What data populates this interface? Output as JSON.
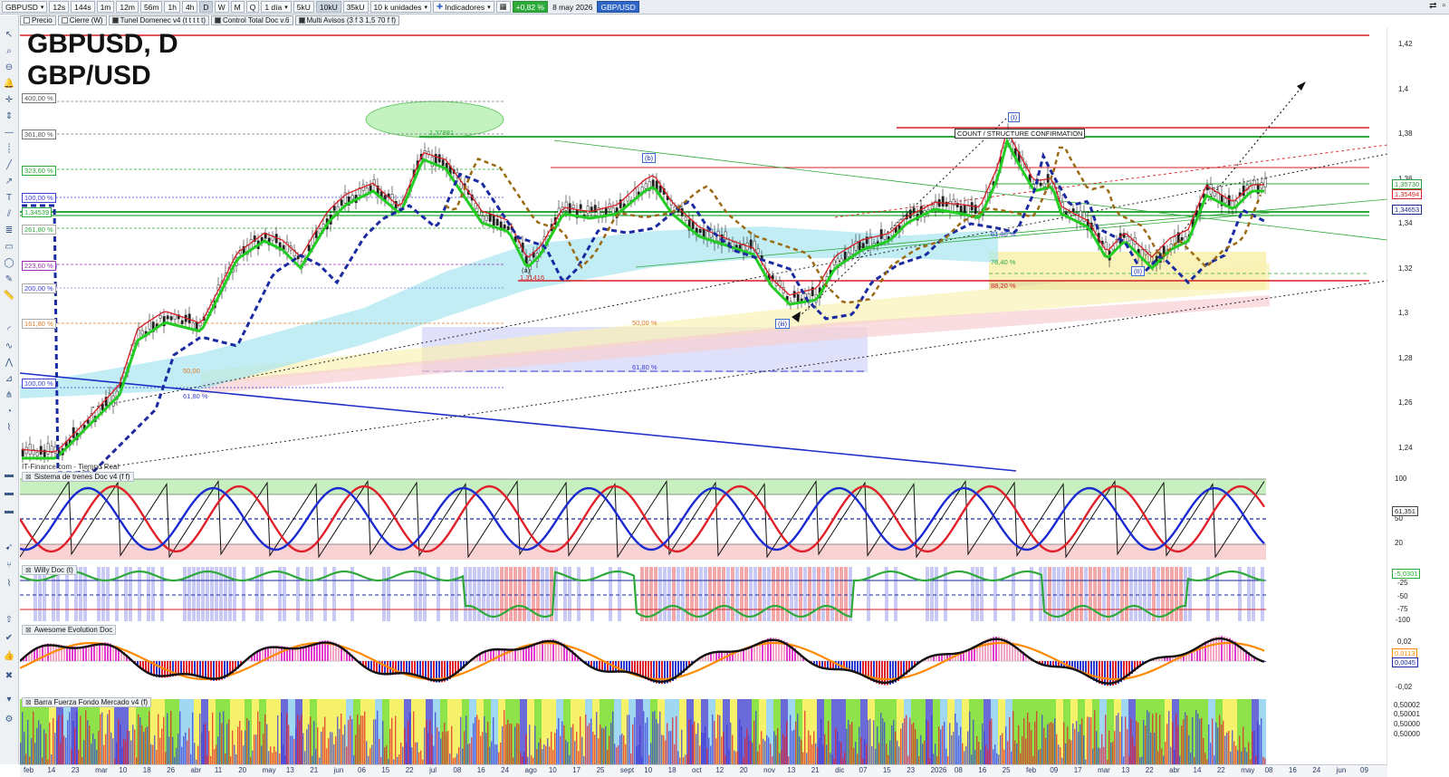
{
  "toolbar": {
    "symbol": "GBPUSD",
    "intervals": [
      "12s",
      "144s",
      "1m",
      "12m",
      "56m",
      "1h",
      "4h",
      "D",
      "W",
      "M",
      "Q"
    ],
    "active_interval": "D",
    "period": "1 día",
    "units": [
      "5kU",
      "10kU",
      "35kU"
    ],
    "active_unit": "10kU",
    "quantity": "10 k unidades",
    "indicators_label": "Indicadores",
    "change": "+0,82 %",
    "date": "8 may 2026",
    "instrument": "GBP/USD"
  },
  "legend": {
    "items": [
      "Precio",
      "Cierre (W)",
      "Tunel Domenec v4 (t t t t t)",
      "Control Total Doc v.6",
      "Multi Avisos (3 f 3 1,5 70 f f)"
    ]
  },
  "title": {
    "line1": "GBPUSD, D",
    "line2": "GBP/USD"
  },
  "source_label": "IT-Finance.com - Tiempo Real",
  "price_axis": {
    "ticks": [
      "1,42",
      "1,4",
      "1,38",
      "1,36",
      "1,34",
      "1,32",
      "1,3",
      "1,28",
      "1,26",
      "1,24"
    ],
    "tags": [
      {
        "text": "1,35730",
        "color": "#2e9a3a"
      },
      {
        "text": "1,35494",
        "color": "#d22"
      },
      {
        "text": "1,34653",
        "color": "#1a2a8a"
      }
    ]
  },
  "fib_left_labels": [
    "400,00 %",
    "361,80 %",
    "323,60 %",
    "100,00 %",
    "1,34539",
    "261,80 %",
    "223,60 %",
    "200,00 %",
    "161,80 %",
    "100,00 %"
  ],
  "annotations": {
    "peak_price": "1,37881",
    "low_price": "1,31416",
    "count_box": "COUNT / STRUCTURE CONFIRMATION",
    "fib_center_50": "50,00 %",
    "fib_center_618": "61,80 %",
    "fib_left_50": "50,00",
    "fib_left_618": "61,80 %",
    "fib_right_618": "61,80 %",
    "fib_right_764": "76,40 %",
    "fib_right_882": "88,20 %",
    "wave_i": "(I)",
    "wave_ii": "(II)",
    "wave_iii": "(iii)",
    "wave_a": "(a)",
    "wave_b": "(b)"
  },
  "panels": {
    "sistema": {
      "title": "Sistema de trenes Doc v4 (f f)",
      "ticks": [
        "100",
        "50",
        "20"
      ],
      "tags": [
        "61,351"
      ]
    },
    "willy": {
      "title": "Willy Doc (t)",
      "ticks": [
        "-25",
        "-50",
        "-75",
        "-100"
      ],
      "tags": [
        "-5,0301"
      ]
    },
    "awesome": {
      "title": "Awesome Evolution Doc",
      "ticks": [
        "0,02",
        "-0,02"
      ],
      "tags": [
        "0,0113",
        "0,0045"
      ]
    },
    "barra": {
      "title": "Barra Fuerza Fondo Mercado v4 (f)",
      "ticks": [
        "0,50002",
        "0,50001",
        "0,50000",
        "0,50000"
      ]
    }
  },
  "x_axis": {
    "labels": [
      "feb",
      "14",
      "23",
      "mar",
      "10",
      "18",
      "26",
      "abr",
      "11",
      "20",
      "may",
      "13",
      "21",
      "jun",
      "06",
      "15",
      "22",
      "jul",
      "08",
      "16",
      "24",
      "ago",
      "10",
      "17",
      "25",
      "sept",
      "10",
      "18",
      "oct",
      "12",
      "20",
      "nov",
      "13",
      "21",
      "dic",
      "07",
      "15",
      "23",
      "2026",
      "08",
      "16",
      "25",
      "feb",
      "09",
      "17",
      "mar",
      "13",
      "22",
      "abr",
      "14",
      "22",
      "may",
      "08",
      "16",
      "24",
      "jun",
      "09"
    ]
  },
  "colors": {
    "green_line": "#2eaa3a",
    "red_line": "#d61f26",
    "blue_dash": "#1a2aa0",
    "accent_blue": "#2f66c6"
  }
}
